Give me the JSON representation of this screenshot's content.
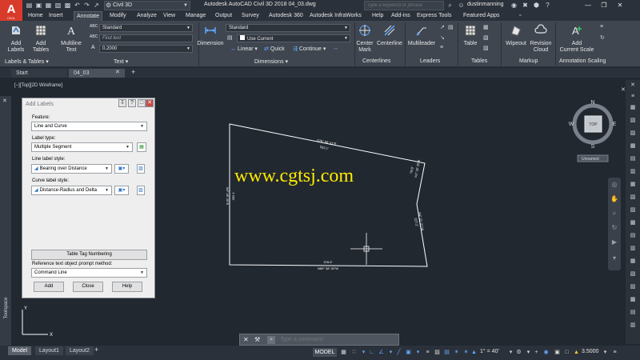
{
  "app": {
    "logo": "A",
    "logo_sub": "CIVIL",
    "title": "Autodesk AutoCAD Civil 3D 2018    04_03.dwg",
    "workspace": "Civil 3D",
    "search_placeholder": "Type a keyword or phrase",
    "user": "dustinmanning"
  },
  "ribbon_tabs": [
    "Home",
    "Insert",
    "Annotate",
    "Modify",
    "Analyze",
    "View",
    "Manage",
    "Output",
    "Survey",
    "Autodesk 360",
    "Autodesk InfraWorks",
    "Help",
    "Add-ins",
    "Express Tools",
    "Featured Apps"
  ],
  "ribbon_active_tab": "Annotate",
  "ribbon": {
    "add_labels": "Add\nLabels",
    "add_tables": "Add\nTables",
    "multiline_text": "Multiline\nText",
    "text_style": "Standard",
    "find_text": "Find text",
    "text_height": "0.2000",
    "dimension": "Dimension",
    "dim_style": "Standard",
    "use_current": "Use Current",
    "linear": "Linear",
    "quick": "Quick",
    "continue": "Continue",
    "center_mark": "Center\nMark",
    "centerline": "Centerline",
    "multileader": "Multileader",
    "table": "Table",
    "wipeout": "Wipeout",
    "revision_cloud": "Revision\nCloud",
    "add_current_scale": "Add\nCurrent Scale",
    "panels": {
      "labels_tables": "Labels & Tables",
      "text": "Text",
      "dimensions": "Dimensions",
      "centerlines": "Centerlines",
      "leaders": "Leaders",
      "tables": "Tables",
      "markup": "Markup",
      "annotation_scaling": "Annotation Scaling"
    }
  },
  "doc_tabs": {
    "start": "Start",
    "drawing": "04_03"
  },
  "viewport": {
    "label": "[−][Top][2D Wireframe]",
    "toolspace": "Toolspace"
  },
  "viewcube": {
    "n": "N",
    "s": "S",
    "e": "E",
    "w": "W",
    "top": "TOP",
    "ucs": "Unnamed"
  },
  "dialog": {
    "title": "Add Labels",
    "feature_label": "Feature:",
    "feature_value": "Line and Curve",
    "label_type_label": "Label type:",
    "label_type_value": "Multiple Segment",
    "line_style_label": "Line label style:",
    "line_style_value": "Bearing over Distance",
    "curve_style_label": "Curve label style:",
    "curve_style_value": "Distance-Radius and Delta",
    "table_tag": "Table Tag Numbering",
    "ref_label": "Reference text object prompt method:",
    "ref_value": "Command Line",
    "add": "Add",
    "close": "Close",
    "help": "Help"
  },
  "drawing": {
    "watermark": "www.cgtsj.com",
    "labels": {
      "top_bearing": "S76° 06' 41\"E",
      "top_dist": "532.1'",
      "bottom_dist": "578.6'",
      "bottom_bearing": "N89° 38' 30\"W",
      "left_bearing": "N4° 49' 20\"E",
      "left_dist": "392.1'",
      "right_upper_a": "N1° 32' 25\"E",
      "right_upper_b": "79.9'",
      "right_lower_a": "S4° 21' 21\"W",
      "right_lower_b": "227.2'"
    },
    "axis_y": "Y",
    "axis_x": "X"
  },
  "command": {
    "placeholder": "Type a command"
  },
  "status": {
    "model_tab": "Model",
    "layout1": "Layout1",
    "layout2": "Layout2",
    "model_space": "MODEL",
    "angle": "1° = 40'",
    "scale": "3.5000"
  },
  "colors": {
    "canvas": "#212830",
    "accent": "#61a9ff",
    "logo": "#d93b2b",
    "watermark": "#ffea00"
  }
}
